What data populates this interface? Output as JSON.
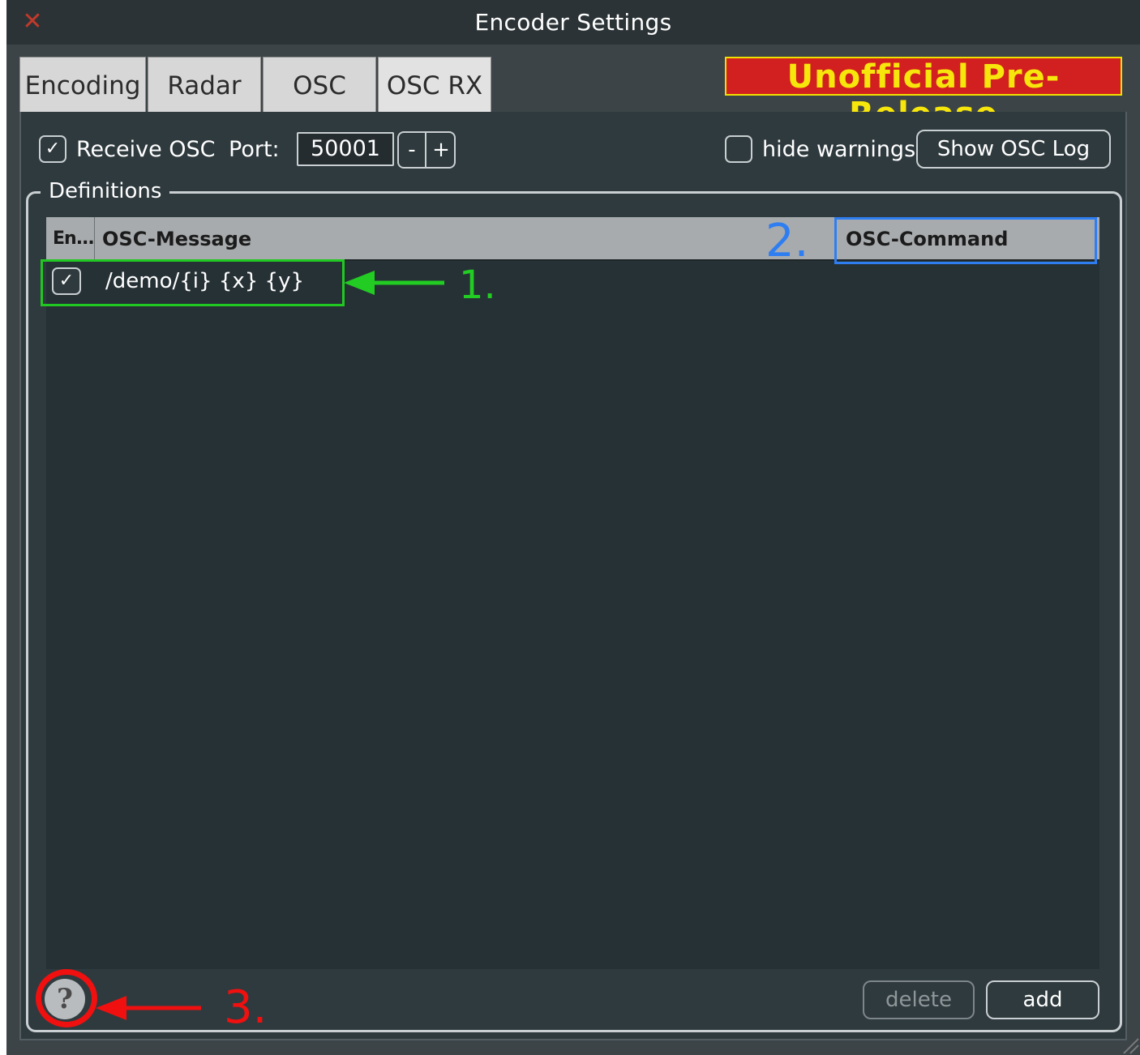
{
  "window": {
    "title": "Encoder  Settings",
    "close_icon": "close-icon"
  },
  "tabs": [
    {
      "label": "Encoding"
    },
    {
      "label": "Radar"
    },
    {
      "label": "OSC"
    },
    {
      "label": "OSC RX",
      "selected": true
    }
  ],
  "banner": {
    "text": "Unofficial Pre-Release",
    "bg_color": "#d21f1f",
    "text_color": "#f7e60b"
  },
  "toolbar": {
    "receive_osc_label": "Receive OSC",
    "receive_osc_checked": true,
    "port_label": "Port:",
    "port_value": "50001",
    "minus_label": "-",
    "plus_label": "+",
    "hide_warnings_label": "hide warnings",
    "hide_warnings_checked": false,
    "show_log_label": "Show OSC Log"
  },
  "definitions": {
    "title": "Definitions",
    "columns": [
      "En...",
      "OSC-Message",
      "OSC-Command"
    ],
    "rows": [
      {
        "enabled": true,
        "message": "/demo/{i} {x} {y}",
        "command": ""
      }
    ],
    "delete_label": "delete",
    "add_label": "add",
    "help_label": "?"
  },
  "annotations": {
    "one": "1.",
    "two": "2.",
    "three": "3.",
    "colors": {
      "one": "#22cc22",
      "two": "#2e7ef2",
      "three": "#f01010"
    }
  }
}
